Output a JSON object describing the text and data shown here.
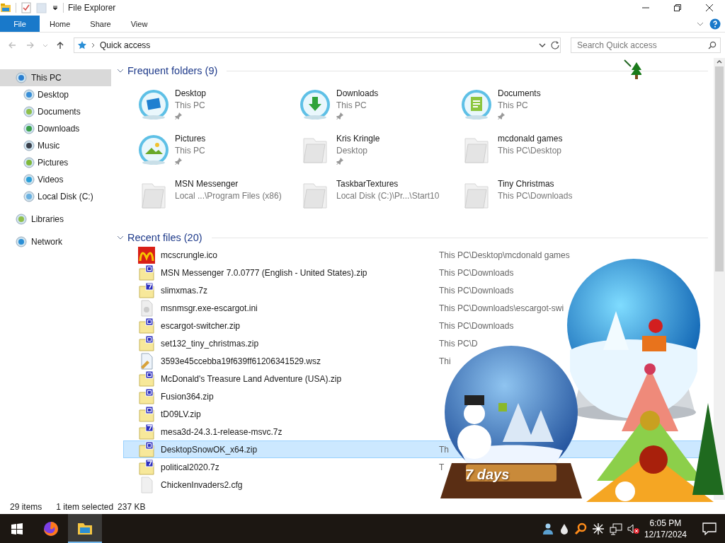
{
  "window": {
    "title": "File Explorer"
  },
  "ribbon_tabs": [
    {
      "label": "File",
      "kind": "file"
    },
    {
      "label": "Home",
      "kind": "tab"
    },
    {
      "label": "Share",
      "kind": "tab"
    },
    {
      "label": "View",
      "kind": "tab"
    }
  ],
  "address_bar": {
    "path": "Quick access"
  },
  "search": {
    "placeholder": "Search Quick access"
  },
  "sidebar": {
    "items": [
      {
        "label": "This PC",
        "kind": "pc",
        "selected": true,
        "children": [
          {
            "label": "Desktop",
            "kind": "desktop",
            "selected": false
          },
          {
            "label": "Documents",
            "kind": "documents",
            "selected": false
          },
          {
            "label": "Downloads",
            "kind": "downloads",
            "selected": false
          },
          {
            "label": "Music",
            "kind": "music",
            "selected": false
          },
          {
            "label": "Pictures",
            "kind": "pictures",
            "selected": false
          },
          {
            "label": "Videos",
            "kind": "videos",
            "selected": false
          },
          {
            "label": "Local Disk (C:)",
            "kind": "disk",
            "selected": false
          }
        ]
      },
      {
        "label": "Libraries",
        "kind": "libraries",
        "selected": false
      },
      {
        "label": "Network",
        "kind": "network",
        "selected": false
      }
    ]
  },
  "frequent_folders": {
    "title": "Frequent folders (9)",
    "expanded": true,
    "items": [
      {
        "name": "Desktop",
        "location": "This PC",
        "kind": "desktop",
        "pinned": true
      },
      {
        "name": "Downloads",
        "location": "This PC",
        "kind": "downloads",
        "pinned": true
      },
      {
        "name": "Documents",
        "location": "This PC",
        "kind": "documents",
        "pinned": true
      },
      {
        "name": "Pictures",
        "location": "This PC",
        "kind": "pictures",
        "pinned": true
      },
      {
        "name": "Kris Kringle",
        "location": "Desktop",
        "kind": "folder",
        "pinned": true
      },
      {
        "name": "mcdonald games",
        "location": "This PC\\Desktop",
        "kind": "folder",
        "pinned": false
      },
      {
        "name": "MSN Messenger",
        "location": "Local ...\\Program Files (x86)",
        "kind": "folder",
        "pinned": false
      },
      {
        "name": "TaskbarTextures",
        "location": "Local Disk (C:)\\Pr...\\Start10",
        "kind": "folder",
        "pinned": false
      },
      {
        "name": "Tiny Christmas",
        "location": "This PC\\Downloads",
        "kind": "folder",
        "pinned": false
      }
    ]
  },
  "recent_files": {
    "title": "Recent files (20)",
    "expanded": true,
    "rows": [
      {
        "name": "mcscrungle.ico",
        "path": "This PC\\Desktop\\mcdonald games",
        "kind": "image",
        "selected": false
      },
      {
        "name": "MSN Messenger 7.0.0777 (English - United States).zip",
        "path": "This PC\\Downloads",
        "kind": "zip",
        "selected": false
      },
      {
        "name": "slimxmas.7z",
        "path": "This PC\\Downloads",
        "kind": "sevenzip",
        "selected": false
      },
      {
        "name": "msnmsgr.exe-escargot.ini",
        "path": "This PC\\Downloads\\escargot-swi",
        "kind": "ini",
        "selected": false
      },
      {
        "name": "escargot-switcher.zip",
        "path": "This PC\\Downloads",
        "kind": "zip",
        "selected": false
      },
      {
        "name": "set132_tiny_christmas.zip",
        "path": "This PC\\D",
        "kind": "zip",
        "selected": false
      },
      {
        "name": "3593e45ccebba19f639ff61206341529.wsz",
        "path": "Thi",
        "kind": "wsz",
        "selected": false
      },
      {
        "name": "McDonald's Treasure Land Adventure (USA).zip",
        "kind": "zip",
        "selected": false
      },
      {
        "name": "Fusion364.zip",
        "kind": "zip",
        "selected": false
      },
      {
        "name": "tD09LV.zip",
        "kind": "zip",
        "selected": false
      },
      {
        "name": "mesa3d-24.3.1-release-msvc.7z",
        "kind": "sevenzip",
        "selected": false
      },
      {
        "name": "DesktopSnowOK_x64.zip",
        "path": "Th",
        "kind": "zip",
        "selected": true
      },
      {
        "name": "political2020.7z",
        "path": "T",
        "kind": "sevenzip",
        "selected": false
      },
      {
        "name": "ChickenInvaders2.cfg",
        "kind": "cfg",
        "selected": false
      }
    ]
  },
  "status_bar": {
    "item_count": "29 items",
    "selection": "1 item selected",
    "size": "237 KB"
  },
  "desktop_gadget": {
    "label": "7 days"
  },
  "taskbar": {
    "apps": [
      {
        "kind": "firefox",
        "active": false
      },
      {
        "kind": "explorer",
        "active": true
      }
    ],
    "time": "6:05 PM",
    "date": "12/17/2024"
  }
}
